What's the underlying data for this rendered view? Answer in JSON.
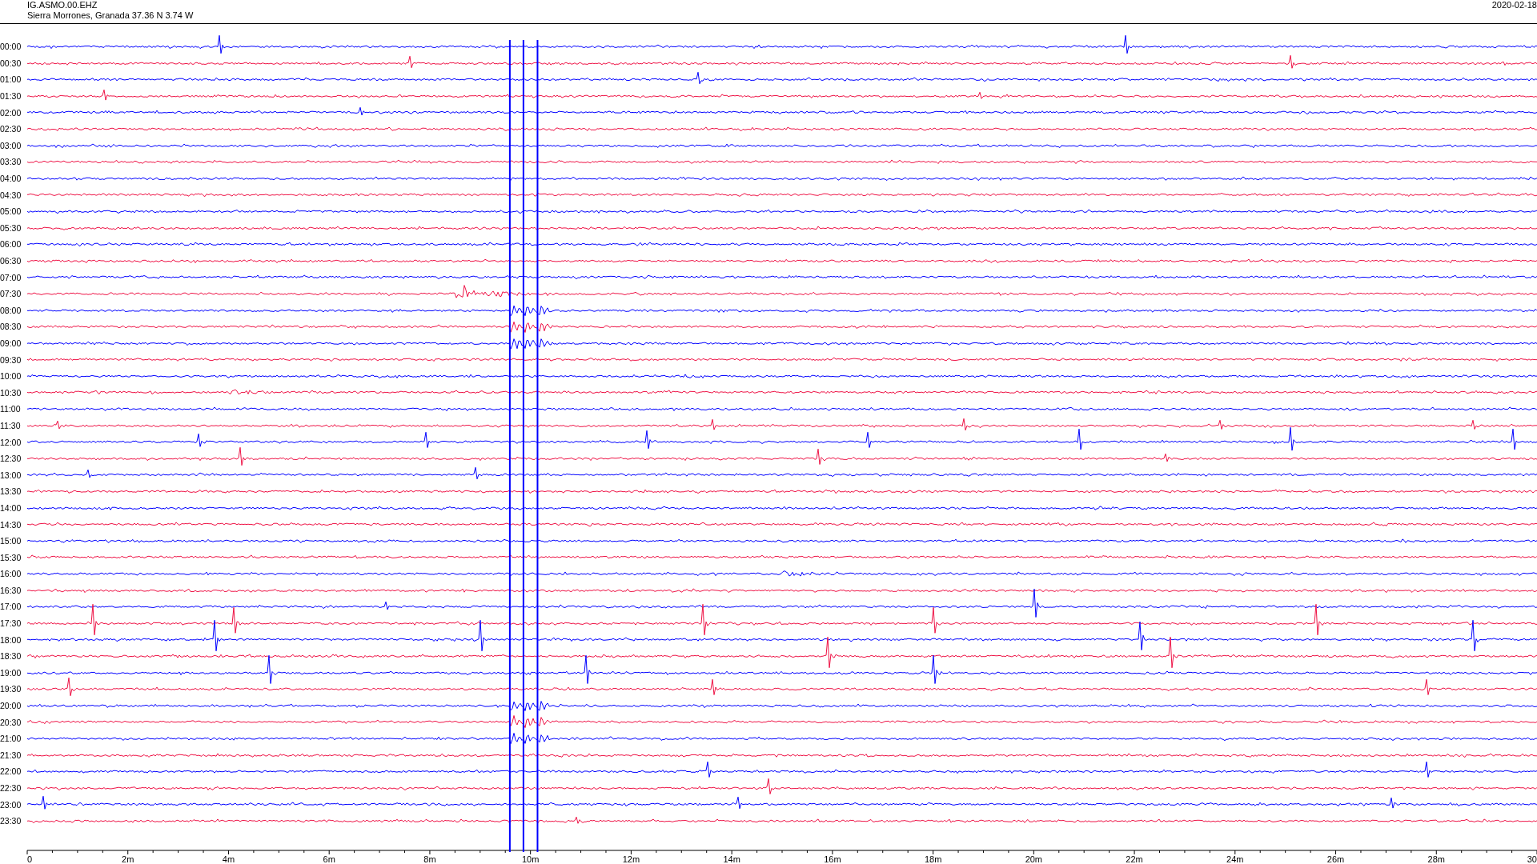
{
  "header": {
    "station": "IG.ASMO.00.EHZ",
    "location": "Sierra Morrones, Granada  37.36 N 3.74 W",
    "date": "2020-02-18"
  },
  "traces": [
    {
      "label": "00:00",
      "color": "#0000ff"
    },
    {
      "label": "00:30",
      "color": "#ee1144"
    },
    {
      "label": "01:00",
      "color": "#0000ff"
    },
    {
      "label": "01:30",
      "color": "#ee1144"
    },
    {
      "label": "02:00",
      "color": "#0000ff"
    },
    {
      "label": "02:30",
      "color": "#ee1144"
    },
    {
      "label": "03:00",
      "color": "#0000ff"
    },
    {
      "label": "03:30",
      "color": "#ee1144"
    },
    {
      "label": "04:00",
      "color": "#0000ff"
    },
    {
      "label": "04:30",
      "color": "#ee1144"
    },
    {
      "label": "05:00",
      "color": "#0000ff"
    },
    {
      "label": "05:30",
      "color": "#ee1144"
    },
    {
      "label": "06:00",
      "color": "#0000ff"
    },
    {
      "label": "06:30",
      "color": "#ee1144"
    },
    {
      "label": "07:00",
      "color": "#0000ff"
    },
    {
      "label": "07:30",
      "color": "#ee1144"
    },
    {
      "label": "08:00",
      "color": "#0000ff"
    },
    {
      "label": "08:30",
      "color": "#ee1144"
    },
    {
      "label": "09:00",
      "color": "#0000ff"
    },
    {
      "label": "09:30",
      "color": "#ee1144"
    },
    {
      "label": "10:00",
      "color": "#0000ff"
    },
    {
      "label": "10:30",
      "color": "#ee1144"
    },
    {
      "label": "11:00",
      "color": "#0000ff"
    },
    {
      "label": "11:30",
      "color": "#ee1144"
    },
    {
      "label": "12:00",
      "color": "#0000ff"
    },
    {
      "label": "12:30",
      "color": "#ee1144"
    },
    {
      "label": "13:00",
      "color": "#0000ff"
    },
    {
      "label": "13:30",
      "color": "#ee1144"
    },
    {
      "label": "14:00",
      "color": "#0000ff"
    },
    {
      "label": "14:30",
      "color": "#ee1144"
    },
    {
      "label": "15:00",
      "color": "#0000ff"
    },
    {
      "label": "15:30",
      "color": "#ee1144"
    },
    {
      "label": "16:00",
      "color": "#0000ff"
    },
    {
      "label": "16:30",
      "color": "#ee1144"
    },
    {
      "label": "17:00",
      "color": "#0000ff"
    },
    {
      "label": "17:30",
      "color": "#ee1144"
    },
    {
      "label": "18:00",
      "color": "#0000ff"
    },
    {
      "label": "18:30",
      "color": "#ee1144"
    },
    {
      "label": "19:00",
      "color": "#0000ff"
    },
    {
      "label": "19:30",
      "color": "#ee1144"
    },
    {
      "label": "20:00",
      "color": "#0000ff"
    },
    {
      "label": "20:30",
      "color": "#ee1144"
    },
    {
      "label": "21:00",
      "color": "#0000ff"
    },
    {
      "label": "21:30",
      "color": "#ee1144"
    },
    {
      "label": "22:00",
      "color": "#0000ff"
    },
    {
      "label": "22:30",
      "color": "#ee1144"
    },
    {
      "label": "23:00",
      "color": "#0000ff"
    },
    {
      "label": "23:30",
      "color": "#ee1144"
    }
  ],
  "x_axis": {
    "ticks": [
      "0",
      "2m",
      "4m",
      "6m",
      "8m",
      "10m",
      "12m",
      "14m",
      "16m",
      "18m",
      "20m",
      "22m",
      "24m",
      "26m",
      "28m",
      "30"
    ]
  }
}
